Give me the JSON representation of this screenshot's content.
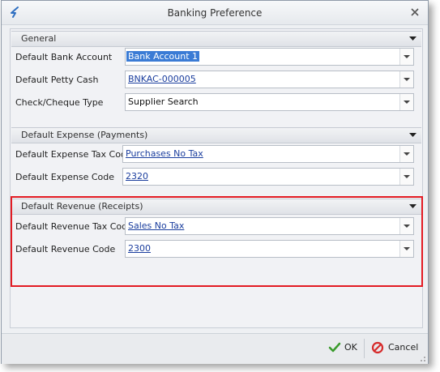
{
  "window": {
    "title": "Banking Preference"
  },
  "sections": {
    "general": {
      "title": "General",
      "rows": [
        {
          "label": "Default Bank Account",
          "value": "Bank Account 1"
        },
        {
          "label": "Default Petty Cash",
          "value": "BNKAC-000005"
        },
        {
          "label": "Check/Cheque Type",
          "value": "Supplier Search"
        }
      ]
    },
    "expense": {
      "title": "Default Expense (Payments)",
      "rows": [
        {
          "label": "Default Expense Tax Code",
          "value": "Purchases No Tax"
        },
        {
          "label": "Default Expense Code",
          "value": "2320"
        }
      ]
    },
    "revenue": {
      "title": "Default Revenue (Receipts)",
      "rows": [
        {
          "label": "Default Revenue Tax Code",
          "value": "Sales No Tax"
        },
        {
          "label": "Default Revenue Code",
          "value": "2300"
        }
      ]
    }
  },
  "footer": {
    "ok_label": "OK",
    "cancel_label": "Cancel"
  },
  "colors": {
    "highlight": "#e31b23",
    "link": "#1b3e9e",
    "selection": "#3a7bd5"
  }
}
